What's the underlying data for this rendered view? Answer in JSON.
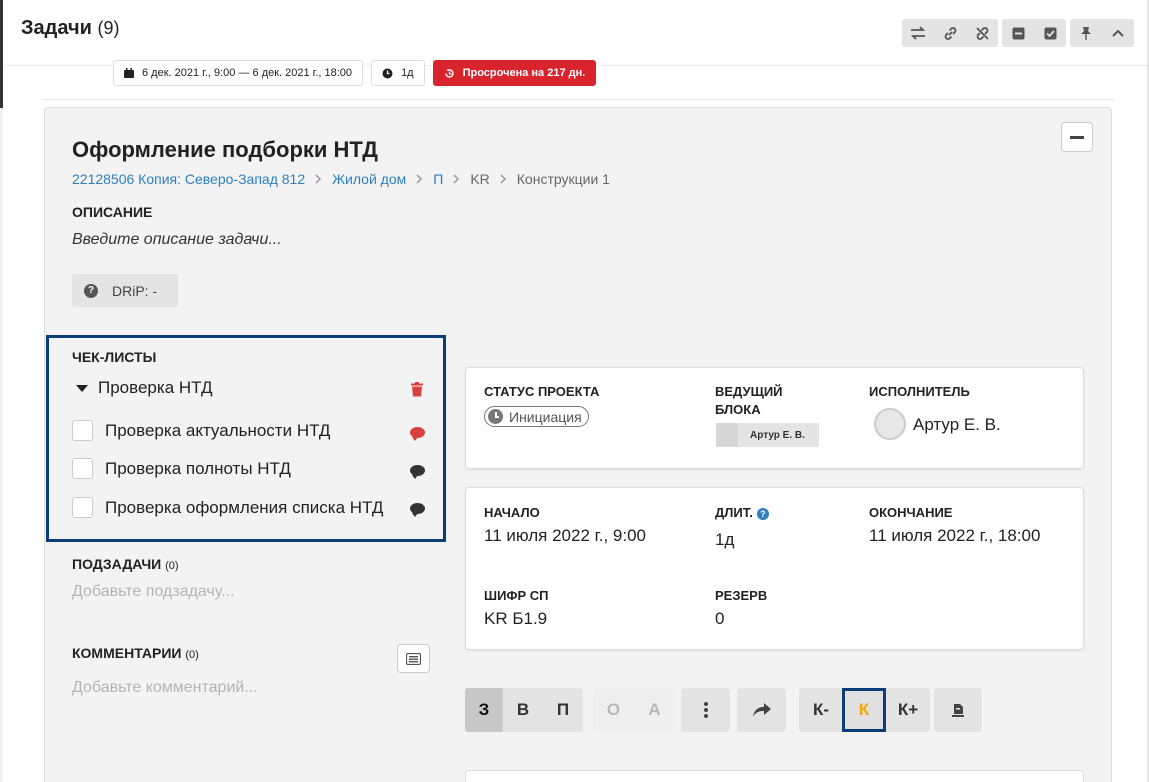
{
  "header": {
    "title": "Задачи",
    "count": "(9)"
  },
  "task_meta": {
    "date_range": "6 дек. 2021 г., 9:00 — 6 дек. 2021 г., 18:00",
    "duration": "1д",
    "overdue": "Просрочена на 217 дн."
  },
  "task": {
    "title": "Оформление подборки НТД",
    "breadcrumb": [
      "22128506 Копия: Северо-Запад 812",
      "Жилой дом",
      "П",
      "KR",
      "Конструкции 1"
    ],
    "description_label": "ОПИСАНИЕ",
    "description_placeholder": "Введите описание задачи...",
    "drip": "DRiP: -"
  },
  "checklists": {
    "label": "ЧЕК-ЛИСТЫ",
    "group_name": "Проверка НТД",
    "items": [
      {
        "label": "Проверка актуальности НТД",
        "checked": false,
        "comment_color": "#d94040"
      },
      {
        "label": "Проверка полноты НТД",
        "checked": false,
        "comment_color": "#333333"
      },
      {
        "label": "Проверка оформления списка НТД",
        "checked": false,
        "comment_color": "#333333"
      }
    ]
  },
  "subtasks": {
    "label": "ПОДЗАДАЧИ",
    "count": "(0)",
    "placeholder": "Добавьте подзадачу..."
  },
  "comments": {
    "label": "КОММЕНТАРИИ",
    "count": "(0)",
    "placeholder": "Добавьте комментарий..."
  },
  "info": {
    "status_label": "СТАТУС ПРОЕКТА",
    "status_value": "Инициация",
    "lead_label_1": "ВЕДУЩИЙ",
    "lead_label_2": "БЛОКА",
    "lead_value": "Артур Е. В.",
    "executor_label": "ИСПОЛНИТЕЛЬ",
    "executor_value": "Артур Е. В."
  },
  "dates": {
    "start_label": "НАЧАЛО",
    "start_value": "11 июля 2022 г., 9:00",
    "duration_label": "ДЛИТ.",
    "duration_value": "1д",
    "end_label": "ОКОНЧАНИЕ",
    "end_value": "11 июля 2022 г., 18:00",
    "cipher_label": "ШИФР СП",
    "cipher_value": "KR Б1.9",
    "reserve_label": "РЕЗЕРВ",
    "reserve_value": "0"
  },
  "bottom_buttons": {
    "z": "З",
    "v": "В",
    "p": "П",
    "o": "О",
    "a": "А",
    "k_minus": "К-",
    "k": "К",
    "k_plus": "К+"
  },
  "colors": {
    "accent_link": "#2d7fc1",
    "overdue": "#d9232d",
    "highlight_border": "#0b3d7a",
    "k_active": "#f0a800"
  },
  "icons": [
    "swap-icon",
    "link-icon",
    "unlink-icon",
    "minus-square-icon",
    "check-square-icon",
    "pin-icon",
    "chevron-up-icon",
    "calendar-icon",
    "clock-icon",
    "history-icon",
    "question-icon",
    "trash-icon",
    "comment-icon",
    "list-icon",
    "dots-vertical-icon",
    "share-icon",
    "stamp-icon"
  ]
}
